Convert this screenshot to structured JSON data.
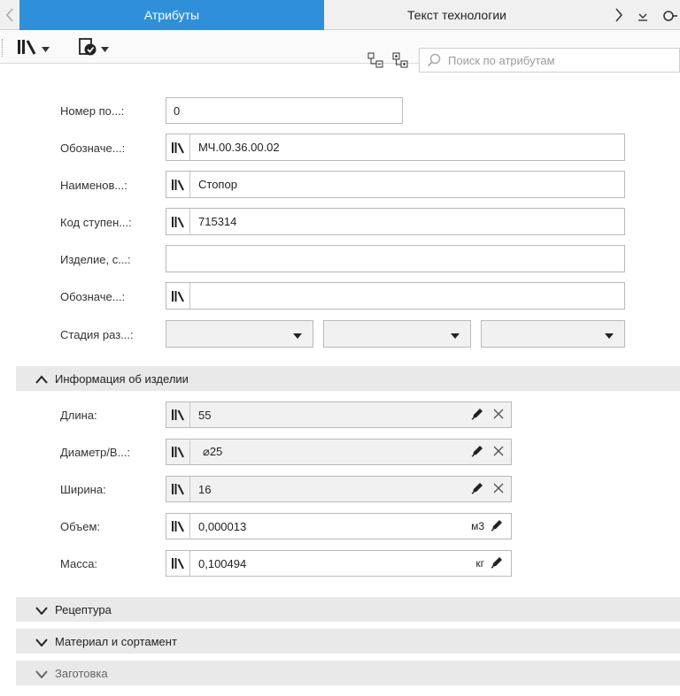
{
  "tabs": {
    "active": "Атрибуты",
    "inactive": "Текст технологии"
  },
  "search": {
    "placeholder": "Поиск по атрибутам"
  },
  "form": {
    "number_label": "Номер по...:",
    "number_value": "0",
    "designation_label": "Обозначе...:",
    "designation_value": "МЧ.00.36.00.02",
    "name_label": "Наименов...:",
    "name_value": "Стопор",
    "stage_code_label": "Код ступен...:",
    "stage_code_value": "715314",
    "product_label": "Изделие, с...:",
    "product_value": "",
    "designation2_label": "Обозначе...:",
    "designation2_value": "",
    "dev_stage_label": "Стадия раз...:"
  },
  "sections": {
    "info_title": "Информация об изделии",
    "recipe_title": "Рецептура",
    "material_title": "Материал и сортамент",
    "blank_title": "Заготовка"
  },
  "info": {
    "length_label": "Длина:",
    "length_value": "55",
    "diameter_label": "Диаметр/В...:",
    "diameter_value": "⌀25",
    "width_label": "Ширина:",
    "width_value": "16",
    "volume_label": "Объем:",
    "volume_value": "0,000013",
    "volume_unit": "м3",
    "mass_label": "Масса:",
    "mass_value": "0,100494",
    "mass_unit": "кг"
  },
  "colors": {
    "accent": "#2f8fd8",
    "section_bg": "#e9e9e9",
    "field_gray": "#f1f1f1"
  }
}
